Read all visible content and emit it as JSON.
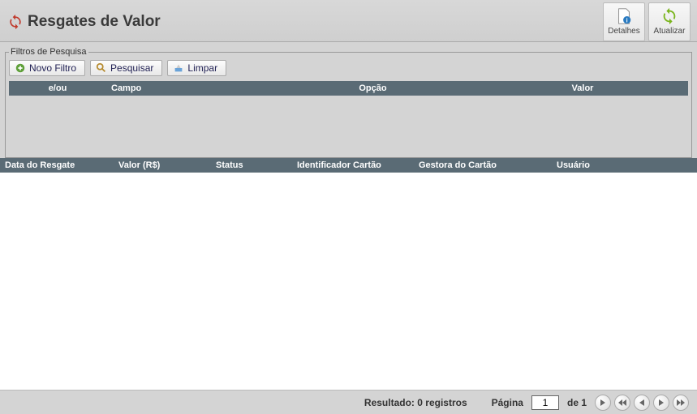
{
  "header": {
    "title": "Resgates de Valor",
    "buttons": {
      "detalhes": "Detalhes",
      "atualizar": "Atualizar"
    }
  },
  "filters": {
    "legend": "Filtros de Pesquisa",
    "buttons": {
      "novo_filtro": "Novo Filtro",
      "pesquisar": "Pesquisar",
      "limpar": "Limpar"
    },
    "columns": {
      "eou": "e/ou",
      "campo": "Campo",
      "opcao": "Opção",
      "valor": "Valor"
    }
  },
  "data": {
    "columns": {
      "data_resgate": "Data do Resgate",
      "valor_rs": "Valor (R$)",
      "status": "Status",
      "identificador_cartao": "Identificador Cartão",
      "gestora_cartao": "Gestora do Cartão",
      "usuario": "Usuário"
    },
    "rows": []
  },
  "footer": {
    "resultado_prefix": "Resultado: ",
    "resultado_count": "0 registros",
    "pagina_label": "Página",
    "pagina_value": "1",
    "de_label": "de 1"
  }
}
